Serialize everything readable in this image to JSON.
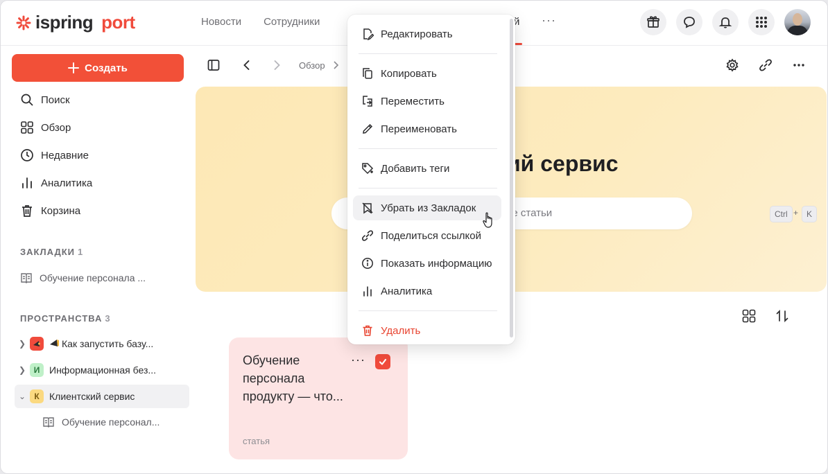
{
  "app": {
    "logo_word1": "ispring",
    "logo_word2": "port",
    "brand_color": "#f04b3c"
  },
  "nav": {
    "items": [
      "Новости",
      "Сотрудники"
    ],
    "active_fragment": "й",
    "more": "···"
  },
  "sidebar": {
    "create_label": "Создать",
    "items": [
      {
        "label": "Поиск",
        "icon": "search-icon"
      },
      {
        "label": "Обзор",
        "icon": "grid-icon"
      },
      {
        "label": "Недавние",
        "icon": "clock-icon"
      },
      {
        "label": "Аналитика",
        "icon": "analytics-icon"
      },
      {
        "label": "Корзина",
        "icon": "trash-icon"
      }
    ],
    "bookmarks": {
      "title": "ЗАКЛАДКИ",
      "count": "1",
      "items": [
        "Обучение персонала ..."
      ]
    },
    "spaces": {
      "title": "ПРОСТРАНСТВА",
      "count": "3",
      "items": [
        {
          "label": "Как запустить базу...",
          "badge": ""
        },
        {
          "label": "Информационная без...",
          "badge": "И"
        },
        {
          "label": "Клиентский сервис",
          "badge": "К"
        }
      ],
      "child": "Обучение персонал..."
    }
  },
  "toolbar": {
    "breadcrumb": "Обзор"
  },
  "hero": {
    "title_fragment": "ий сервис",
    "search_placeholder_fragment": "ие статьи",
    "kbd_ctrl": "Ctrl",
    "kbd_plus": "+",
    "kbd_k": "K"
  },
  "card": {
    "title": "Обучение персонала продукту — что...",
    "dots": "···",
    "type": "статья"
  },
  "menu": {
    "items": [
      {
        "label": "Редактировать",
        "icon": "edit-doc-icon"
      },
      {
        "label": "Копировать",
        "icon": "copy-icon"
      },
      {
        "label": "Переместить",
        "icon": "move-icon"
      },
      {
        "label": "Переименовать",
        "icon": "pencil-icon"
      },
      {
        "label": "Добавить теги",
        "icon": "tag-icon"
      },
      {
        "label": "Убрать из Закладок",
        "icon": "bookmark-remove-icon"
      },
      {
        "label": "Поделиться ссылкой",
        "icon": "link-icon"
      },
      {
        "label": "Показать информацию",
        "icon": "info-icon"
      },
      {
        "label": "Аналитика",
        "icon": "analytics-icon"
      },
      {
        "label": "Удалить",
        "icon": "trash-icon"
      }
    ]
  }
}
